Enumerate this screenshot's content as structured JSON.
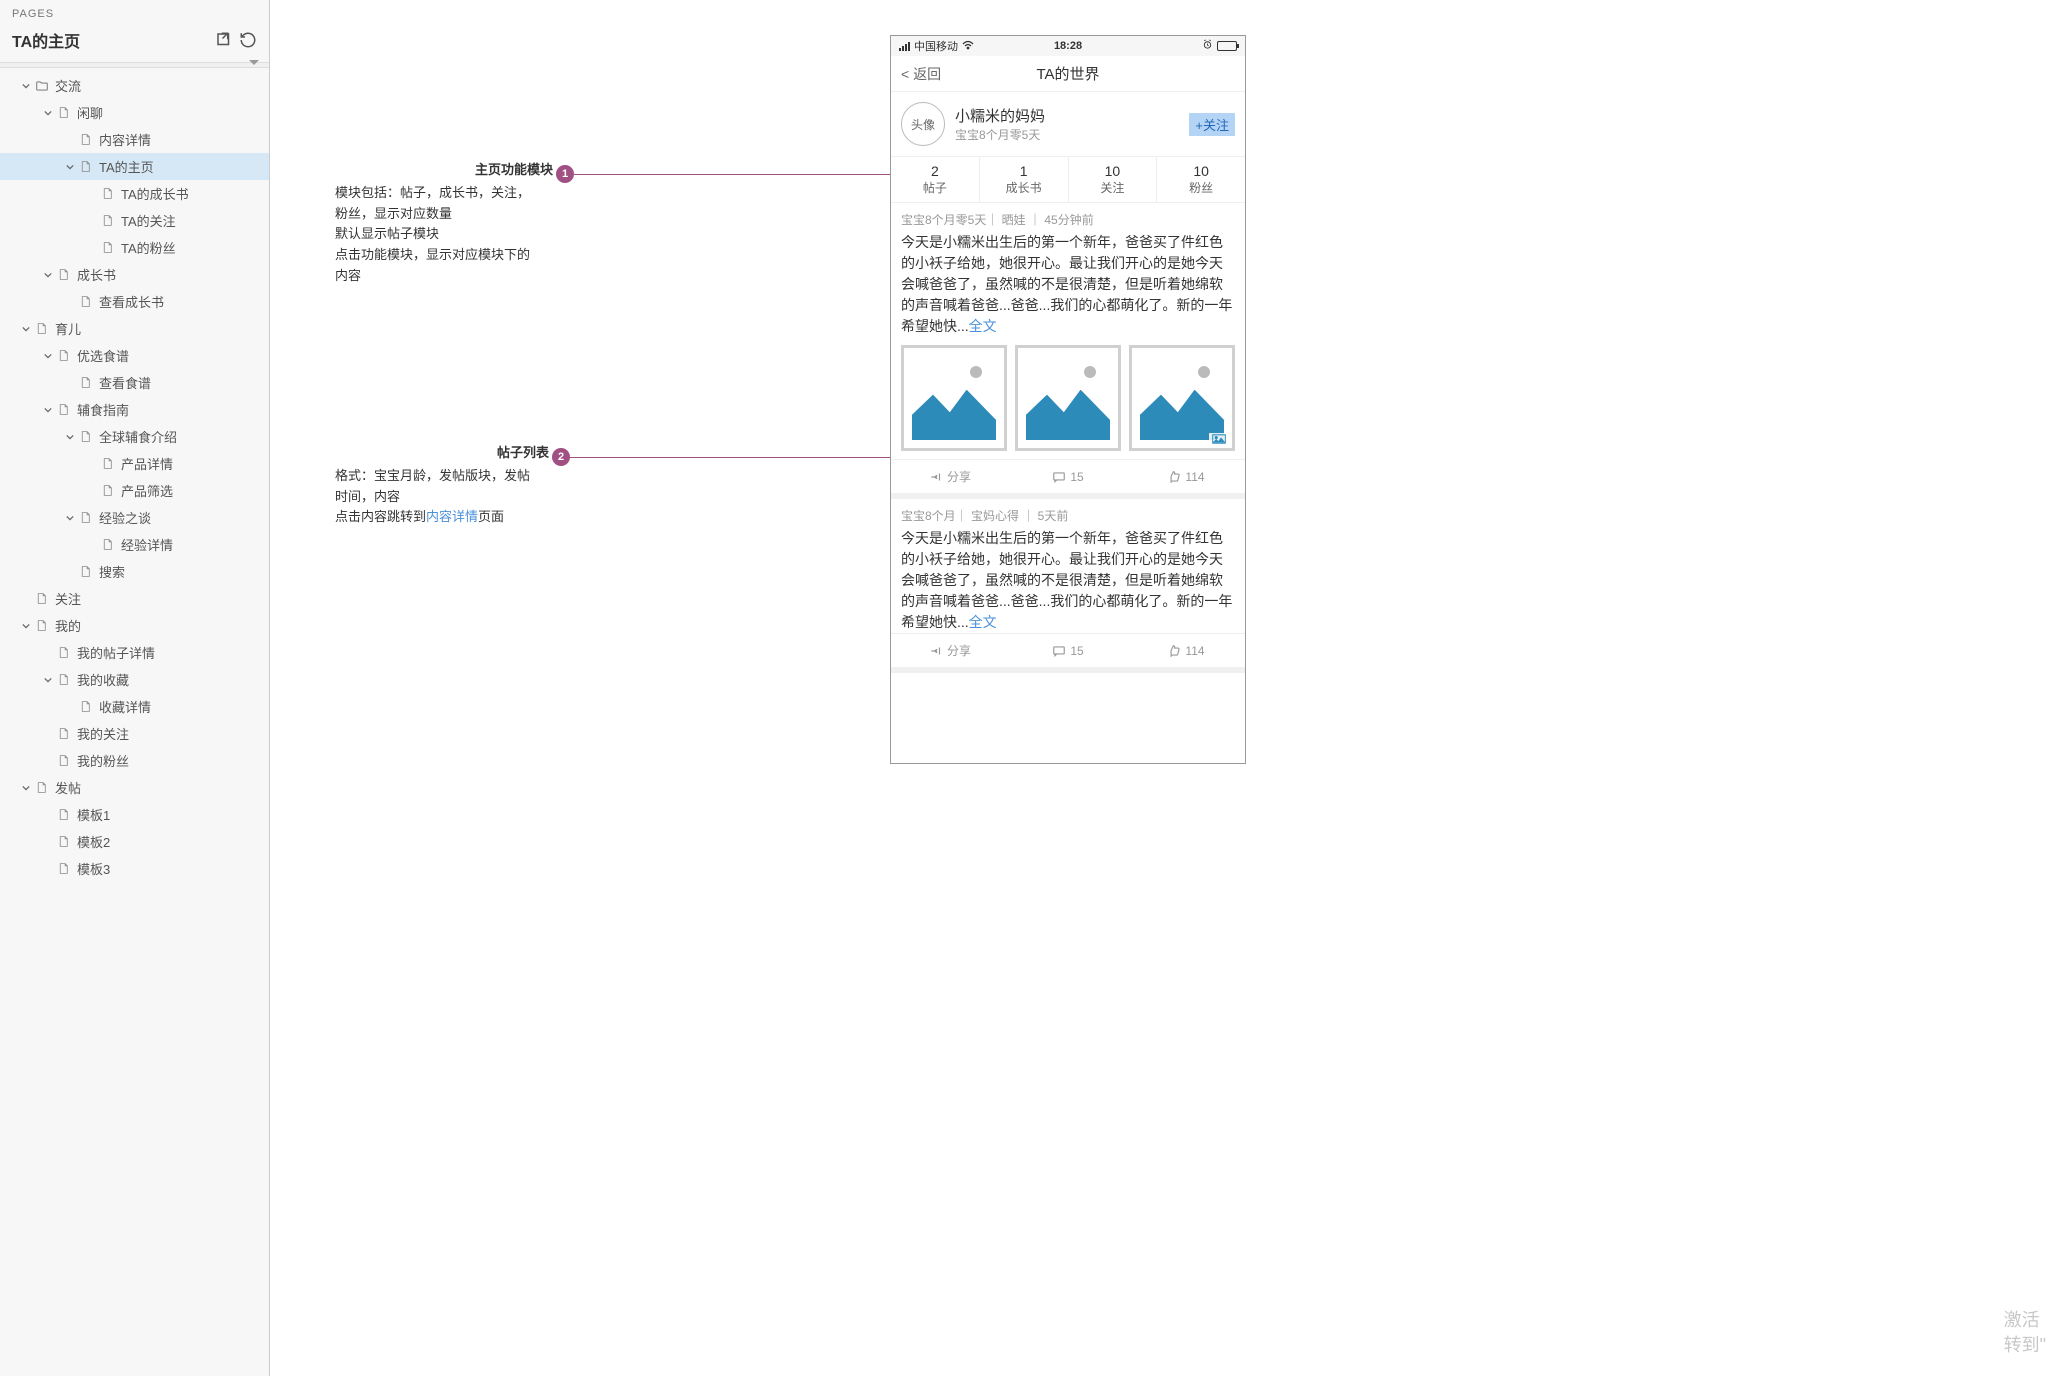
{
  "sidebar": {
    "header": "PAGES",
    "title": "TA的主页",
    "tree": [
      {
        "lvl": 0,
        "toggle": true,
        "open": true,
        "type": "folder",
        "label": "交流"
      },
      {
        "lvl": 1,
        "toggle": true,
        "open": true,
        "type": "page",
        "label": "闲聊"
      },
      {
        "lvl": 2,
        "toggle": false,
        "type": "page",
        "label": "内容详情"
      },
      {
        "lvl": 2,
        "toggle": true,
        "open": true,
        "type": "page",
        "label": "TA的主页",
        "selected": true
      },
      {
        "lvl": 3,
        "toggle": false,
        "type": "page",
        "label": "TA的成长书"
      },
      {
        "lvl": 3,
        "toggle": false,
        "type": "page",
        "label": "TA的关注"
      },
      {
        "lvl": 3,
        "toggle": false,
        "type": "page",
        "label": "TA的粉丝"
      },
      {
        "lvl": 1,
        "toggle": true,
        "open": true,
        "type": "page",
        "label": "成长书"
      },
      {
        "lvl": 2,
        "toggle": false,
        "type": "page",
        "label": "查看成长书"
      },
      {
        "lvl": 0,
        "toggle": true,
        "open": true,
        "type": "page",
        "label": "育儿"
      },
      {
        "lvl": 1,
        "toggle": true,
        "open": true,
        "type": "page",
        "label": "优选食谱"
      },
      {
        "lvl": 2,
        "toggle": false,
        "type": "page",
        "label": "查看食谱"
      },
      {
        "lvl": 1,
        "toggle": true,
        "open": true,
        "type": "page",
        "label": "辅食指南"
      },
      {
        "lvl": 2,
        "toggle": true,
        "open": true,
        "type": "page",
        "label": "全球辅食介绍"
      },
      {
        "lvl": 3,
        "toggle": false,
        "type": "page",
        "label": "产品详情"
      },
      {
        "lvl": 3,
        "toggle": false,
        "type": "page",
        "label": "产品筛选"
      },
      {
        "lvl": 2,
        "toggle": true,
        "open": true,
        "type": "page",
        "label": "经验之谈"
      },
      {
        "lvl": 3,
        "toggle": false,
        "type": "page",
        "label": "经验详情"
      },
      {
        "lvl": 2,
        "toggle": false,
        "type": "page",
        "label": "搜索"
      },
      {
        "lvl": 0,
        "toggle": false,
        "type": "page",
        "label": "关注"
      },
      {
        "lvl": 0,
        "toggle": true,
        "open": true,
        "type": "page",
        "label": "我的"
      },
      {
        "lvl": 1,
        "toggle": false,
        "type": "page",
        "label": "我的帖子详情"
      },
      {
        "lvl": 1,
        "toggle": true,
        "open": true,
        "type": "page",
        "label": "我的收藏"
      },
      {
        "lvl": 2,
        "toggle": false,
        "type": "page",
        "label": "收藏详情"
      },
      {
        "lvl": 1,
        "toggle": false,
        "type": "page",
        "label": "我的关注"
      },
      {
        "lvl": 1,
        "toggle": false,
        "type": "page",
        "label": "我的粉丝"
      },
      {
        "lvl": 0,
        "toggle": true,
        "open": true,
        "type": "page",
        "label": "发帖"
      },
      {
        "lvl": 1,
        "toggle": false,
        "type": "page",
        "label": "模板1"
      },
      {
        "lvl": 1,
        "toggle": false,
        "type": "page",
        "label": "模板2"
      },
      {
        "lvl": 1,
        "toggle": false,
        "type": "page",
        "label": "模板3"
      }
    ]
  },
  "annotations": {
    "a1": {
      "num": "1",
      "title": "主页功能模块",
      "lines": [
        "模块包括：帖子，成长书，关注，",
        "粉丝，显示对应数量",
        "默认显示帖子模块",
        "点击功能模块，显示对应模块下的",
        "内容"
      ]
    },
    "a2": {
      "num": "2",
      "title": "帖子列表",
      "line_pre": "格式：宝宝月龄，发帖版块，发帖",
      "line_pre2": "时间，内容",
      "line_click": "点击内容跳转到",
      "link": "内容详情",
      "line_after": "页面"
    }
  },
  "phone": {
    "status": {
      "carrier": "中国移动",
      "time": "18:28"
    },
    "nav": {
      "back": "返回",
      "title": "TA的世界"
    },
    "profile": {
      "avatar": "头像",
      "name": "小糯米的妈妈",
      "sub": "宝宝8个月零5天",
      "follow": "+关注"
    },
    "tabs": [
      {
        "n": "2",
        "l": "帖子"
      },
      {
        "n": "1",
        "l": "成长书"
      },
      {
        "n": "10",
        "l": "关注"
      },
      {
        "n": "10",
        "l": "粉丝"
      }
    ],
    "posts": [
      {
        "meta": "宝宝8个月零5天｜ 晒娃 ｜ 45分钟前",
        "body": "今天是小糯米出生后的第一个新年，爸爸买了件红色的小袄子给她，她很开心。最让我们开心的是她今天会喊爸爸了，虽然喊的不是很清楚，但是听着她绵软的声音喊着爸爸...爸爸...我们的心都萌化了。新的一年希望她快...",
        "more": "全文",
        "thumbs": 3,
        "share": "分享",
        "comment": "15",
        "like": "114"
      },
      {
        "meta": "宝宝8个月｜ 宝妈心得 ｜ 5天前",
        "body": "今天是小糯米出生后的第一个新年，爸爸买了件红色的小袄子给她，她很开心。最让我们开心的是她今天会喊爸爸了，虽然喊的不是很清楚，但是听着她绵软的声音喊着爸爸...爸爸...我们的心都萌化了。新的一年希望她快...",
        "more": "全文",
        "thumbs": 0,
        "share": "分享",
        "comment": "15",
        "like": "114"
      }
    ]
  },
  "watermark": {
    "l1": "激活",
    "l2": "转到\""
  }
}
